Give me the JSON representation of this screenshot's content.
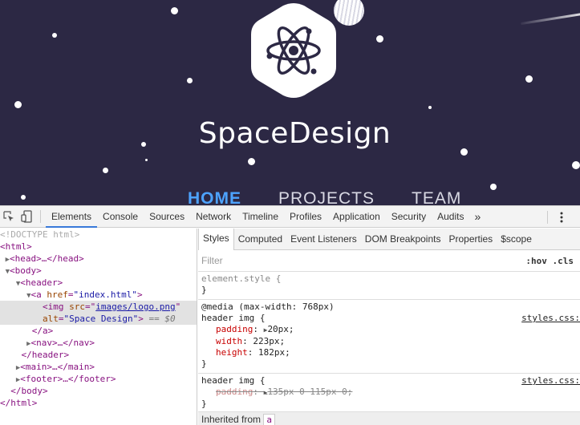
{
  "preview": {
    "site_title": "SpaceDesign",
    "nav": [
      {
        "label": "HOME",
        "active": true
      },
      {
        "label": "PROJECTS",
        "active": false
      },
      {
        "label": "TEAM",
        "active": false
      }
    ],
    "colors": {
      "background": "#2c2844",
      "nav_active": "#4da3ff",
      "logo_icon": "#2c2844"
    }
  },
  "devtools": {
    "main_tabs": [
      "Elements",
      "Console",
      "Sources",
      "Network",
      "Timeline",
      "Profiles",
      "Application",
      "Security",
      "Audits"
    ],
    "active_tab": "Elements",
    "more_label": "»",
    "dom": {
      "doctype": "<!DOCTYPE html>",
      "html_open": "<html>",
      "head": "<head>…</head>",
      "body_open": "<body>",
      "header_open": "<header>",
      "a_tag_open": "<a ",
      "a_href_name": "href",
      "a_href_value": "\"index.html\"",
      "a_close_bracket": ">",
      "img_open": "<img ",
      "img_src_name": "src",
      "img_src_value": "images/logo.png",
      "img_alt_name": "alt",
      "img_alt_value": "\"Space Design\"",
      "img_selected_marker": "== $0",
      "a_close": "</a>",
      "nav": "<nav>…</nav>",
      "header_close": "</header>",
      "main": "<main>…</main>",
      "footer": "<footer>…</footer>",
      "body_close": "</body>",
      "html_close": "</html>"
    },
    "styles": {
      "tabs": [
        "Styles",
        "Computed",
        "Event Listeners",
        "DOM Breakpoints",
        "Properties",
        "$scope"
      ],
      "active_tab": "Styles",
      "filter_placeholder": "Filter",
      "filter_buttons": ":hov  .cls",
      "element_style_selector": "element.style {",
      "brace_close": "}",
      "media_query": "@media (max-width: 768px)",
      "rule1_selector": "header img {",
      "rule1_source": "styles.css:",
      "rule1_props": [
        {
          "name": "padding",
          "value": "20px;",
          "expandable": true
        },
        {
          "name": "width",
          "value": "223px;",
          "expandable": false
        },
        {
          "name": "height",
          "value": "182px;",
          "expandable": false
        }
      ],
      "rule2_selector": "header img {",
      "rule2_source": "styles.css:",
      "rule2_prop": {
        "name": "padding",
        "value": "135px 0 115px 0;",
        "overridden": true
      },
      "inherited_label": "Inherited from",
      "inherited_tag": "a"
    }
  }
}
